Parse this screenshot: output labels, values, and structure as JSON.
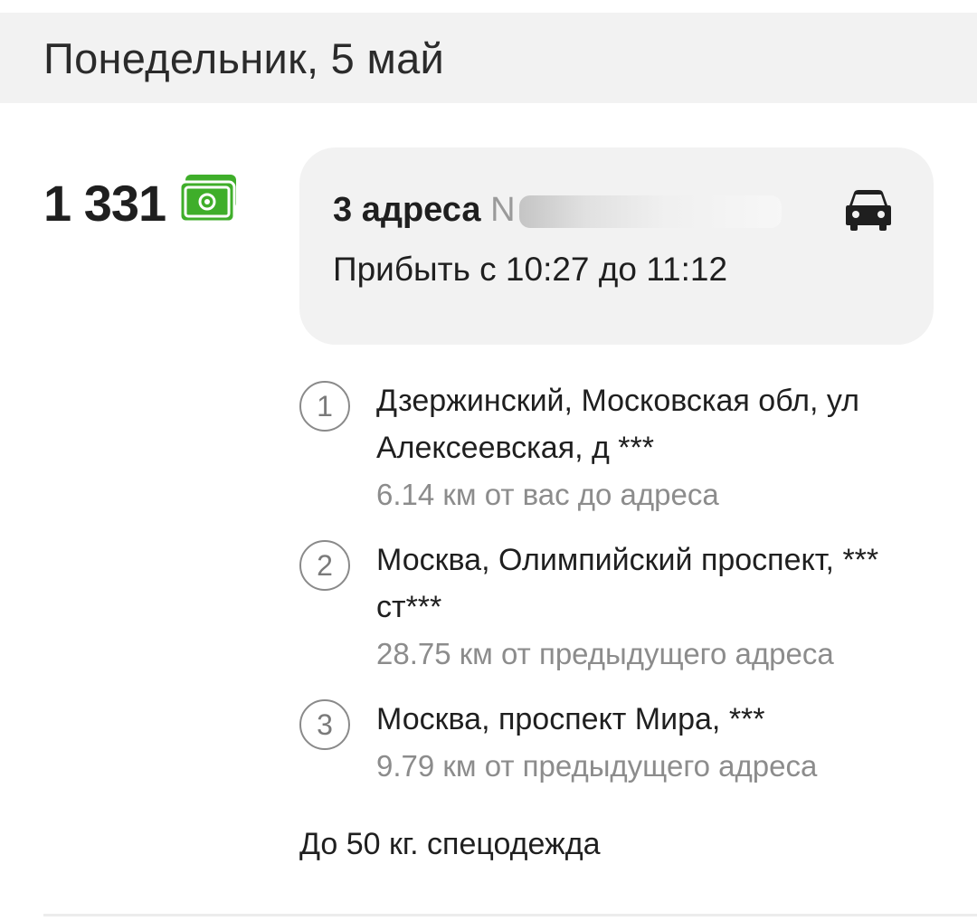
{
  "header": {
    "date": "Понедельник, 5 май"
  },
  "order": {
    "price": "1 331",
    "payment_icon": "cash-icon",
    "title": "3 адреса",
    "number_prefix": "N",
    "transport_icon": "car-icon",
    "arrival_window": "Прибыть с 10:27 до 11:12",
    "addresses": [
      {
        "index": "1",
        "line": "Дзержинский, Московская обл, ул Алексеевская, д ***",
        "distance": "6.14 км от вас до адреса"
      },
      {
        "index": "2",
        "line": "Москва, Олимпийский проспект, *** ст***",
        "distance": "28.75 км от предыдущего адреса"
      },
      {
        "index": "3",
        "line": "Москва, проспект Мира, ***",
        "distance": "9.79 км от предыдущего адреса"
      }
    ],
    "note": "До 50 кг. спецодежда"
  },
  "colors": {
    "cash_green": "#3fae2a",
    "card_bg": "#f2f2f2",
    "secondary_text": "#8c8c8c"
  }
}
